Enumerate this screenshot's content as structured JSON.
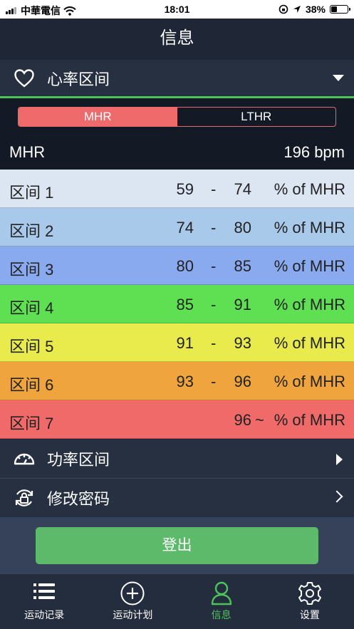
{
  "status_bar": {
    "carrier": "中華電信",
    "time": "18:01",
    "battery": "38%",
    "battery_level": 0.38
  },
  "header": {
    "title": "信息"
  },
  "heart_section": {
    "label": "心率区间",
    "icon": "heart-icon"
  },
  "segmented": {
    "options": [
      "MHR",
      "LTHR"
    ],
    "selected": "MHR"
  },
  "mhr": {
    "label": "MHR",
    "value": "196 bpm"
  },
  "zones": [
    {
      "name": "区间 1",
      "low": "59",
      "sep": "-",
      "high": "74",
      "unit": "% of MHR",
      "color": "#dbe6f2"
    },
    {
      "name": "区间 2",
      "low": "74",
      "sep": "-",
      "high": "80",
      "unit": "% of MHR",
      "color": "#a9c9ea"
    },
    {
      "name": "区间 3",
      "low": "80",
      "sep": "-",
      "high": "85",
      "unit": "% of MHR",
      "color": "#8aaaf0"
    },
    {
      "name": "区间 4",
      "low": "85",
      "sep": "-",
      "high": "91",
      "unit": "% of MHR",
      "color": "#5fe052"
    },
    {
      "name": "区间 5",
      "low": "91",
      "sep": "-",
      "high": "93",
      "unit": "% of MHR",
      "color": "#e9eb4c"
    },
    {
      "name": "区间 6",
      "low": "93",
      "sep": "-",
      "high": "96",
      "unit": "% of MHR",
      "color": "#f0a43d"
    },
    {
      "name": "区间 7",
      "low": "96",
      "sep": "~",
      "high": "",
      "unit": "% of MHR",
      "color": "#f06a6a"
    }
  ],
  "menu": {
    "power": {
      "label": "功率区间",
      "icon": "speedometer-icon"
    },
    "password": {
      "label": "修改密码",
      "icon": "lock-refresh-icon"
    }
  },
  "logout": {
    "label": "登出"
  },
  "tabs": [
    {
      "label": "运动记录",
      "icon": "list-icon",
      "active": false
    },
    {
      "label": "运动计划",
      "icon": "plus-circle-icon",
      "active": false
    },
    {
      "label": "信息",
      "icon": "user-icon",
      "active": true
    },
    {
      "label": "设置",
      "icon": "gear-icon",
      "active": false
    }
  ],
  "colors": {
    "accent_green": "#4ec35a",
    "accent_red": "#ee6a6b",
    "background": "#1f2736"
  }
}
